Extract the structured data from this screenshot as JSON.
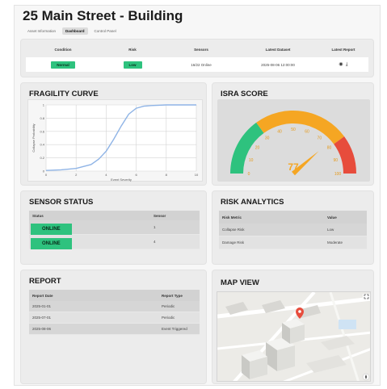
{
  "title": "25 Main Street - Building",
  "tabs": [
    {
      "label": "Asset Information"
    },
    {
      "label": "Dashboard"
    },
    {
      "label": "Control Panel"
    }
  ],
  "summary": {
    "headers": [
      "Condition",
      "Risk",
      "Sensors",
      "Latest Dataset",
      "Latest Report"
    ],
    "condition": "Normal",
    "risk": "Low",
    "sensors": "16/22 Online",
    "latest_dataset": "2025-08-06 12:00:00",
    "report_icons": [
      "eye-icon",
      "download-icon"
    ]
  },
  "fragility": {
    "title": "FRAGILITY CURVE",
    "chart_data": {
      "type": "line",
      "xlabel": "Event Severity",
      "ylabel": "Collapse Probability",
      "xlim": [
        0,
        10
      ],
      "ylim": [
        0,
        1
      ],
      "x_ticks": [
        "0",
        "2",
        "4",
        "6",
        "8",
        "10"
      ],
      "y_ticks": [
        "0",
        "0.2",
        "0.4",
        "0.6",
        "0.8",
        "1"
      ],
      "x": [
        0,
        1,
        2,
        3,
        3.5,
        4,
        4.5,
        5,
        5.5,
        6,
        6.5,
        7,
        8,
        9,
        10
      ],
      "y": [
        0.01,
        0.02,
        0.04,
        0.1,
        0.18,
        0.3,
        0.48,
        0.68,
        0.86,
        0.95,
        0.98,
        0.99,
        1.0,
        1.0,
        1.0
      ],
      "color": "#8fb4e6",
      "grid": true
    }
  },
  "isra": {
    "title": "ISRA SCORE",
    "value": "77",
    "ticks": [
      "0",
      "10",
      "20",
      "30",
      "40",
      "50",
      "60",
      "70",
      "80",
      "90",
      "100"
    ],
    "min": 0,
    "max": 100,
    "score": 77,
    "colors": {
      "low": "#2ec27e",
      "mid": "#f5a623",
      "high": "#e74c3c",
      "needle": "#f5a623"
    }
  },
  "sensor_status": {
    "title": "SENSOR STATUS",
    "headers": [
      "Status",
      "Sensor"
    ],
    "rows": [
      {
        "status": "ONLINE",
        "sensor": "1"
      },
      {
        "status": "ONLINE",
        "sensor": "4"
      }
    ]
  },
  "risk_analytics": {
    "title": "RISK ANALYTICS",
    "headers": [
      "Risk Metric",
      "Value"
    ],
    "rows": [
      {
        "metric": "Collapse Risk",
        "value": "Low"
      },
      {
        "metric": "Damage Risk",
        "value": "Moderate"
      }
    ]
  },
  "report": {
    "title": "REPORT",
    "headers": [
      "Report Date",
      "Report Type"
    ],
    "rows": [
      {
        "date": "2025-01-01",
        "type": "Periodic"
      },
      {
        "date": "2025-07-01",
        "type": "Periodic"
      },
      {
        "date": "2025-08-06",
        "type": "Event Triggered"
      }
    ]
  },
  "map": {
    "title": "MAP VIEW",
    "pin_color": "#e74c3c",
    "icons": [
      "expand-icon",
      "map-pin-icon",
      "compass-icon"
    ]
  },
  "colors": {
    "accent_green": "#2ec27e",
    "panel": "#ececec",
    "line": "#8fb4e6"
  }
}
